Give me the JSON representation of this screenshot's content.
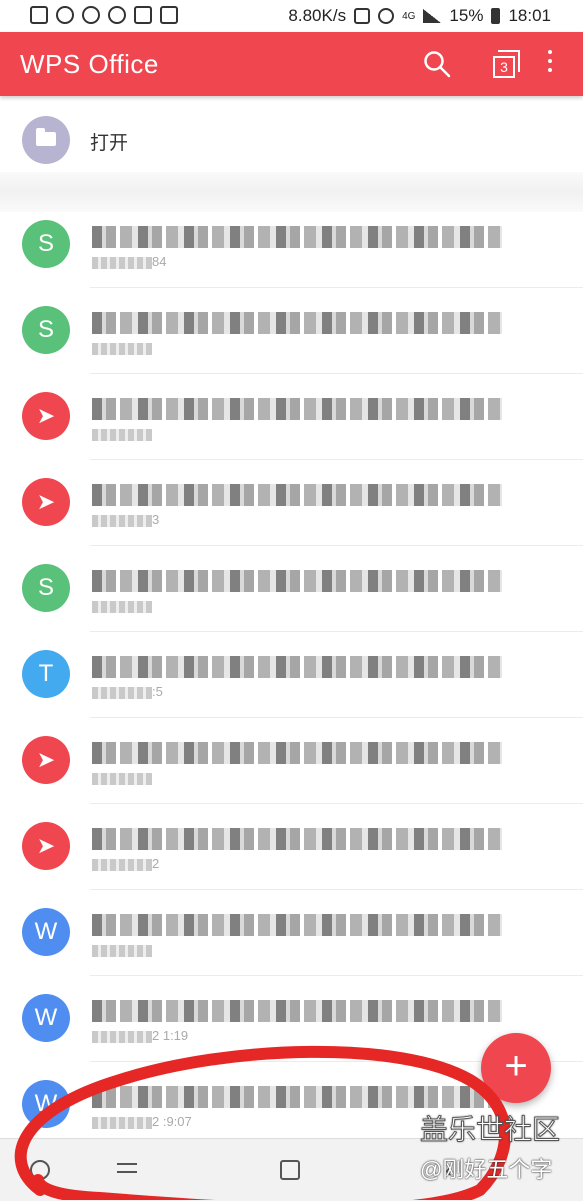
{
  "status_bar": {
    "speed": "8.80K/s",
    "network": "4G",
    "battery": "15%",
    "time": "18:01"
  },
  "app_bar": {
    "title": "WPS Office",
    "tab_count": "3",
    "icons": [
      "search-icon",
      "tabs-icon",
      "more-vert-icon"
    ]
  },
  "open_item": {
    "label": "打开",
    "icon": "folder-icon"
  },
  "files": [
    {
      "type": "sheet",
      "letter": "S",
      "meta": "84"
    },
    {
      "type": "sheet",
      "letter": "S",
      "meta": ""
    },
    {
      "type": "pdf",
      "letter": "➤",
      "meta": ""
    },
    {
      "type": "pdf",
      "letter": "➤",
      "meta": "3"
    },
    {
      "type": "sheet",
      "letter": "S",
      "meta": ""
    },
    {
      "type": "text",
      "letter": "T",
      "meta": ":5"
    },
    {
      "type": "pdf",
      "letter": "➤",
      "meta": ""
    },
    {
      "type": "pdf",
      "letter": "➤",
      "meta": "2"
    },
    {
      "type": "word",
      "letter": "W",
      "meta": ""
    },
    {
      "type": "word",
      "letter": "W",
      "meta": "2 1:19"
    },
    {
      "type": "word",
      "letter": "W",
      "meta": "2 :9:07"
    }
  ],
  "fab": {
    "symbol": "+"
  },
  "watermark": {
    "line1": "盖乐世社区",
    "line2": "@刚好五个字"
  },
  "colors": {
    "brand_red": "#f0464f",
    "sheet_green": "#59c17a",
    "text_blue": "#43aaf0",
    "word_blue": "#4f8ef0"
  }
}
